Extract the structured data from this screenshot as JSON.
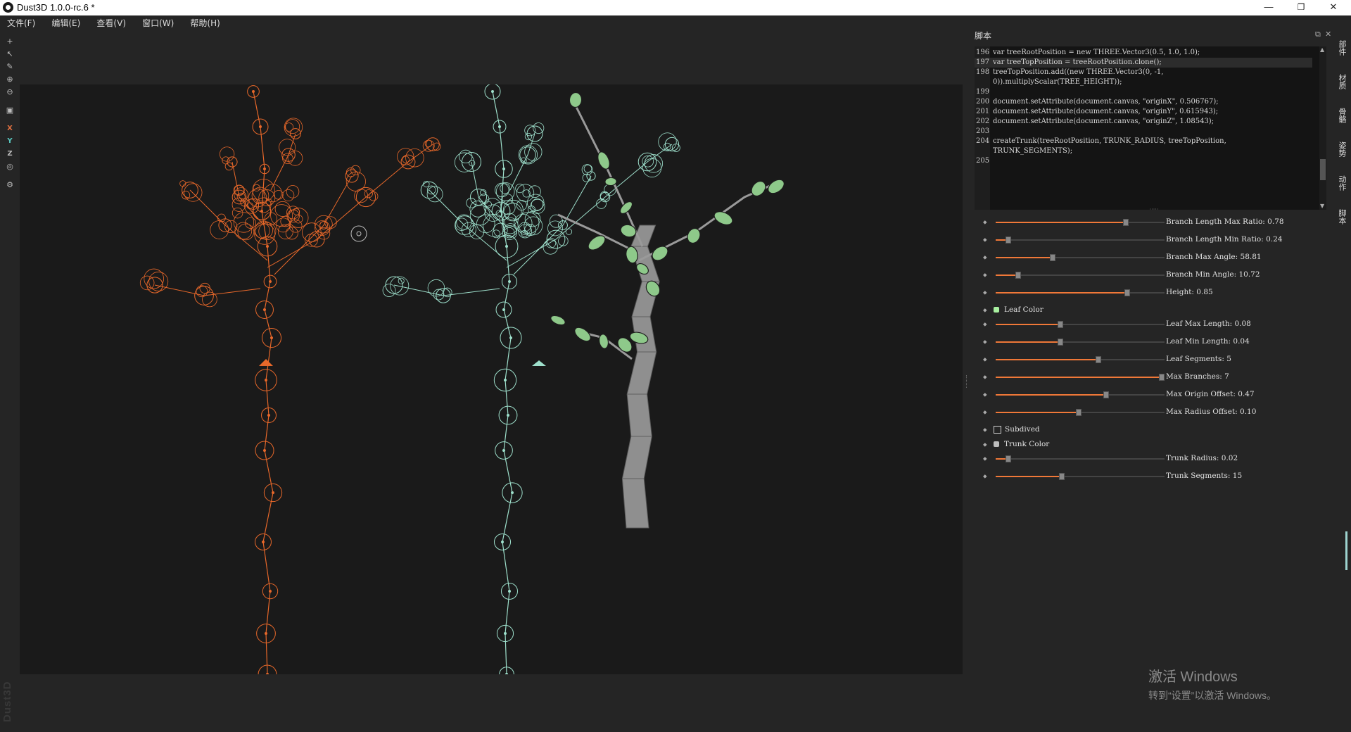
{
  "window": {
    "title": "Dust3D 1.0.0-rc.6 *",
    "minimize": "—",
    "maximize": "❐",
    "close": "✕"
  },
  "menu": [
    "文件(F)",
    "编辑(E)",
    "查看(V)",
    "窗口(W)",
    "帮助(H)"
  ],
  "toolbar": {
    "add": "+",
    "select": "↖",
    "paint": "✎",
    "zoom_in": "⊕",
    "zoom_out": "⊖",
    "frame": "▣",
    "x_mirror": "X",
    "y_mirror": "Y",
    "z_mirror": "Z",
    "radius": "◎",
    "settings": "⚙"
  },
  "watermark": "Dust3D",
  "panel": {
    "title": "脚本",
    "float": "⧉",
    "close": "✕"
  },
  "code": [
    {
      "ln": "196",
      "text": "var treeRootPosition = new THREE.Vector3(0.5, 1.0, 1.0);"
    },
    {
      "ln": "197",
      "text": "var treeTopPosition = treeRootPosition.clone();"
    },
    {
      "ln": "198",
      "text": "treeTopPosition.add((new THREE.Vector3(0, -1,"
    },
    {
      "ln": "",
      "text": "0)).multiplyScalar(TREE_HEIGHT));"
    },
    {
      "ln": "199",
      "text": ""
    },
    {
      "ln": "200",
      "text": "document.setAttribute(document.canvas, \"originX\", 0.506767);"
    },
    {
      "ln": "201",
      "text": "document.setAttribute(document.canvas, \"originY\", 0.615943);"
    },
    {
      "ln": "202",
      "text": "document.setAttribute(document.canvas, \"originZ\", 1.08543);"
    },
    {
      "ln": "203",
      "text": ""
    },
    {
      "ln": "204",
      "text": "createTrunk(treeRootPosition, TRUNK_RADIUS, treeTopPosition,"
    },
    {
      "ln": "",
      "text": "TRUNK_SEGMENTS);"
    },
    {
      "ln": "205",
      "text": ""
    }
  ],
  "params": [
    {
      "type": "slider",
      "label": "Branch Length Max Ratio: 0.78",
      "value": 0.78
    },
    {
      "type": "slider",
      "label": "Branch Length Min Ratio: 0.24",
      "value": 0.06
    },
    {
      "type": "slider",
      "label": "Branch Max Angle: 58.81",
      "value": 0.33
    },
    {
      "type": "slider",
      "label": "Branch Min Angle: 10.72",
      "value": 0.12
    },
    {
      "type": "slider",
      "label": "Height: 0.85",
      "value": 0.79
    },
    {
      "type": "color",
      "label": "Leaf Color",
      "color": "#a8f0a0"
    },
    {
      "type": "slider",
      "label": "Leaf Max Length: 0.08",
      "value": 0.38
    },
    {
      "type": "slider",
      "label": "Leaf Min Length: 0.04",
      "value": 0.38
    },
    {
      "type": "slider",
      "label": "Leaf Segments: 5",
      "value": 0.61
    },
    {
      "type": "slider",
      "label": "Max Branches: 7",
      "value": 1.0
    },
    {
      "type": "slider",
      "label": "Max Origin Offset: 0.47",
      "value": 0.66
    },
    {
      "type": "slider",
      "label": "Max Radius Offset: 0.10",
      "value": 0.49
    },
    {
      "type": "checkbox",
      "label": "Subdived",
      "checked": false
    },
    {
      "type": "color",
      "label": "Trunk Color",
      "color": "#bdbdbd"
    },
    {
      "type": "slider",
      "label": "Trunk Radius: 0.02",
      "value": 0.06
    },
    {
      "type": "slider",
      "label": "Trunk Segments: 15",
      "value": 0.39
    }
  ],
  "side_tabs": [
    "部件",
    "材质",
    "骨骼",
    "姿势",
    "动作",
    "脚本"
  ],
  "activation": {
    "line1": "激活 Windows",
    "line2": "转到“设置”以激活 Windows。"
  },
  "colors": {
    "orange": "#e8682a",
    "teal": "#9ee0cc",
    "leaf": "#8ec98a"
  }
}
